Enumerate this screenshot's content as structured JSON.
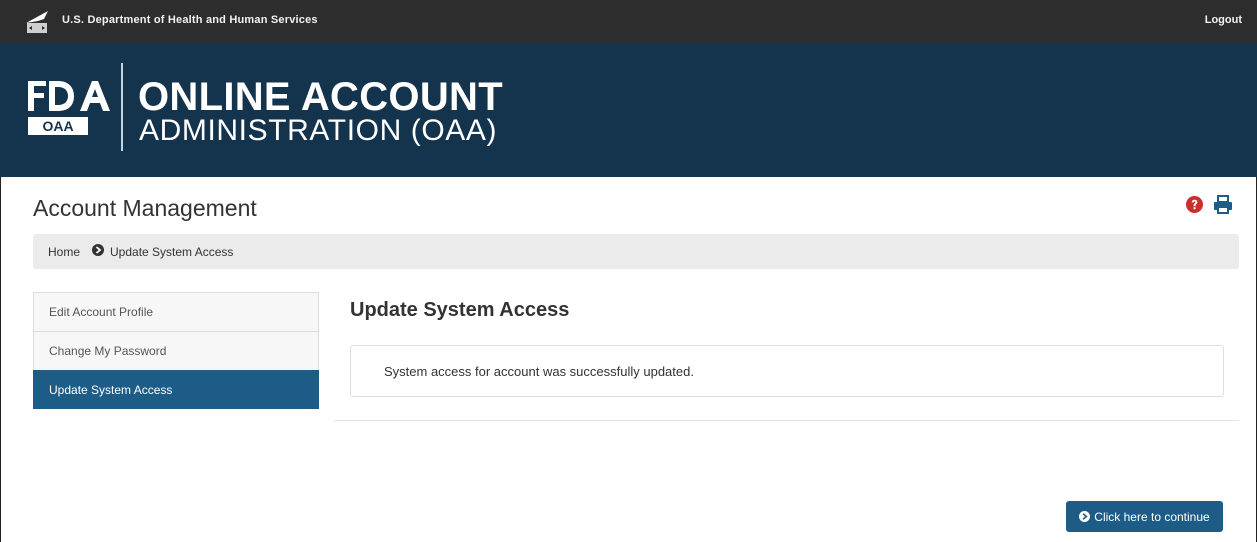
{
  "header": {
    "agency": "U.S. Department of Health and Human Services",
    "logout_label": "Logout",
    "logo_icon": "hhs-eagle-icon"
  },
  "banner": {
    "logo_icon": "fda-oaa-logo",
    "logo_sublabel": "OAA",
    "title_line1": "ONLINE ACCOUNT",
    "title_line2": "ADMINISTRATION (OAA)"
  },
  "page": {
    "title": "Account Management",
    "help_icon": "question-circle-icon",
    "print_icon": "print-icon"
  },
  "breadcrumb": {
    "home": "Home",
    "current": "Update System Access"
  },
  "sidebar": {
    "items": [
      {
        "label": "Edit Account Profile"
      },
      {
        "label": "Change My Password"
      },
      {
        "label": "Update System Access"
      }
    ]
  },
  "main": {
    "heading": "Update System Access",
    "message": "System access for account was successfully updated.",
    "continue_label": "Click here to continue"
  },
  "colors": {
    "topbar": "#2d2d2d",
    "banner": "#14344d",
    "accent": "#1d5c87",
    "help_red": "#c9302c"
  }
}
